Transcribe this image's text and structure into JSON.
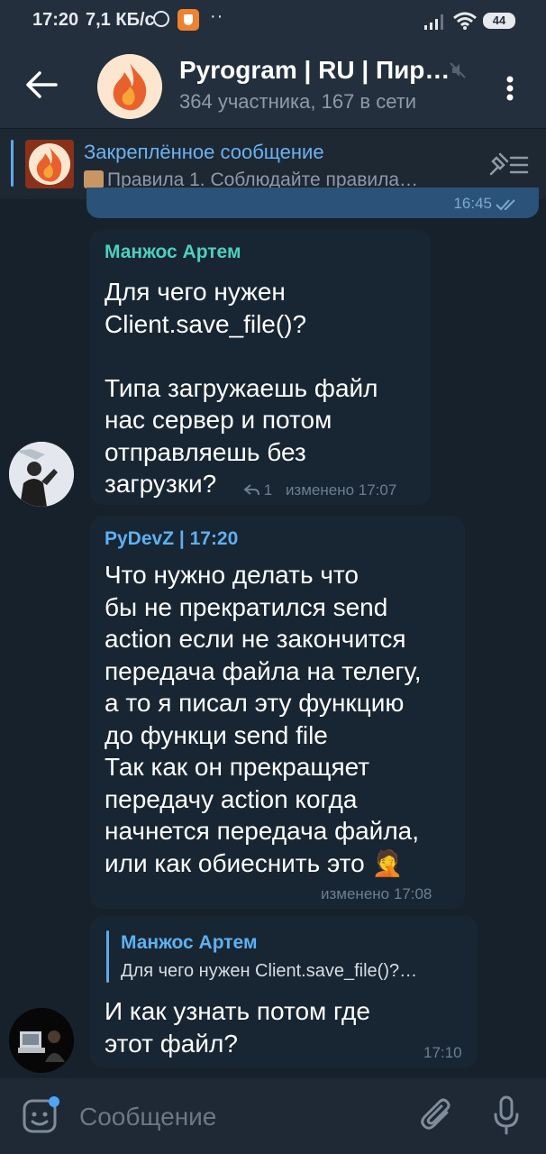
{
  "status": {
    "time": "17:20",
    "speed": "7,1 КБ/с",
    "dots": "··",
    "battery": "44"
  },
  "header": {
    "title": "Pyrogram | RU | Пир…",
    "subtitle": "364 участника, 167 в сети"
  },
  "pinned": {
    "title": "Закреплённое сообщение",
    "text": "Правила    1. Соблюдайте правила…"
  },
  "previous_message": {
    "time": "16:45"
  },
  "messages": [
    {
      "sender": "Манжос Артем",
      "text_line1": "Для чего нужен",
      "text_line2": "Client.save_file()?",
      "text_line3": "Типа загружаешь файл",
      "text_line4": "нас сервер и потом",
      "text_line5": "отправляешь без",
      "text_line6": "загрузки?",
      "replies": "1",
      "edited": "изменено 17:07"
    },
    {
      "sender": "PyDevZ | 17:20",
      "lines": [
        "Что нужно делать что",
        "бы не прекратился send",
        "action если не закончится",
        "передача файла на телегу,",
        "а то я писал эту функцию",
        "до функци send file",
        "Так как он прекращяет",
        "передачу action когда",
        "начнется передача файла,",
        "или как обиеснить это 🤦"
      ],
      "edited": "изменено 17:08"
    },
    {
      "reply_to_sender": "Манжос Артем",
      "reply_to_text": "Для чего нужен Client.save_file()?…",
      "line1": "И как узнать потом где",
      "line2": "этот файл?",
      "time": "17:10"
    }
  ],
  "composer": {
    "placeholder": "Сообщение"
  },
  "colors": {
    "background": "#17212b",
    "bubble": "#182533",
    "outgoing_bubble": "#2b5278",
    "sender_teal": "#4fcfbf",
    "sender_blue": "#5fb0f0",
    "link_blue": "#6ab2f2"
  }
}
